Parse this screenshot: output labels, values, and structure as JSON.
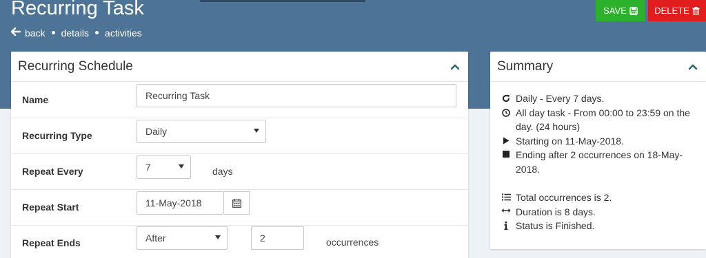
{
  "header": {
    "title": "Recurring Task",
    "nav": {
      "back": "back",
      "details": "details",
      "activities": "activities"
    }
  },
  "actions": {
    "save_label": "SAVE",
    "delete_label": "DELETE"
  },
  "schedule": {
    "title": "Recurring Schedule",
    "name": {
      "label": "Name",
      "value": "Recurring Task"
    },
    "type": {
      "label": "Recurring Type",
      "value": "Daily"
    },
    "repeat_every": {
      "label": "Repeat Every",
      "value": "7",
      "unit": "days"
    },
    "repeat_start": {
      "label": "Repeat Start",
      "value": "11-May-2018"
    },
    "repeat_ends": {
      "label": "Repeat Ends",
      "mode": "After",
      "count": "2",
      "unit": "occurrences"
    }
  },
  "summary": {
    "title": "Summary",
    "lines": [
      {
        "icon": "refresh-icon",
        "text": "Daily - Every 7 days."
      },
      {
        "icon": "clock-icon",
        "text": "All day task - From 00:00 to 23:59 on the day. (24 hours)"
      },
      {
        "icon": "play-icon",
        "text": "Starting on 11-May-2018."
      },
      {
        "icon": "stop-icon",
        "text": "Ending after 2 occurrences on 18-May-2018."
      },
      {
        "icon": "list-icon",
        "text": "Total occurrences is 2."
      },
      {
        "icon": "arrows-h-icon",
        "text": "Duration is 8 days."
      },
      {
        "icon": "info-icon",
        "text": "Status is Finished."
      }
    ]
  },
  "colors": {
    "header_bg": "#4d7397",
    "save_bg": "#2bb12b",
    "delete_bg": "#e11d1d",
    "chevron": "#2a6a6a"
  }
}
